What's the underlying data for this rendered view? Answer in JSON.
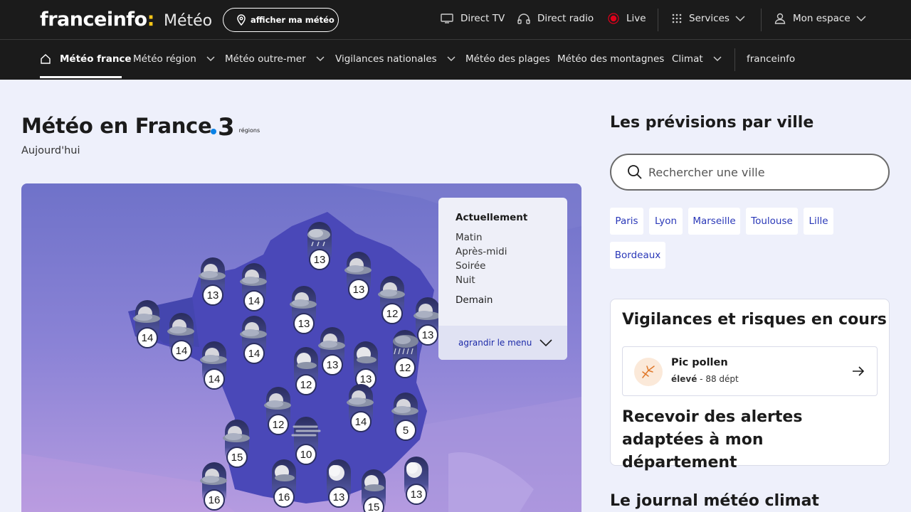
{
  "header": {
    "logo_main": "franceinfo",
    "logo_colon": ":",
    "logo_section": "Météo",
    "locate_button": "afficher ma météo",
    "nav": {
      "direct_tv": "Direct TV",
      "direct_radio": "Direct radio",
      "live": "Live",
      "services": "Services",
      "account": "Mon espace"
    }
  },
  "subnav": {
    "items": [
      "Météo france",
      "Météo région",
      "Météo outre-mer",
      "Vigilances nationales",
      "Météo des plages",
      "Météo des montagnes",
      "Climat",
      "franceinfo"
    ]
  },
  "main": {
    "title": "Météo en France",
    "partner_number": "3",
    "partner_label": "régions",
    "subtitle": "Aujourd'hui"
  },
  "map": {
    "markers": [
      {
        "temp": "13",
        "icon": "cloudy-rain-icon"
      },
      {
        "temp": "13",
        "icon": "cloudy-icon"
      },
      {
        "temp": "14",
        "icon": "cloudy-icon"
      },
      {
        "temp": "13",
        "icon": "cloudy-icon"
      },
      {
        "temp": "12",
        "icon": "cloudy-icon"
      },
      {
        "temp": "13",
        "icon": "cloudy-icon"
      },
      {
        "temp": "14",
        "icon": "cloudy-icon"
      },
      {
        "temp": "14",
        "icon": "cloudy-icon"
      },
      {
        "temp": "14",
        "icon": "cloudy-icon"
      },
      {
        "temp": "13",
        "icon": "cloudy-icon"
      },
      {
        "temp": "13",
        "icon": "cloudy-icon"
      },
      {
        "temp": "13",
        "icon": "sun-cloud-icon"
      },
      {
        "temp": "12",
        "icon": "storm-rain-icon"
      },
      {
        "temp": "14",
        "icon": "cloudy-icon"
      },
      {
        "temp": "12",
        "icon": "sun-cloud-icon"
      },
      {
        "temp": "12",
        "icon": "cloudy-icon"
      },
      {
        "temp": "14",
        "icon": "cloudy-icon"
      },
      {
        "temp": "5",
        "icon": "cloudy-icon"
      },
      {
        "temp": "15",
        "icon": "cloudy-icon"
      },
      {
        "temp": "10",
        "icon": "fog-icon"
      },
      {
        "temp": "16",
        "icon": "cloudy-icon"
      },
      {
        "temp": "16",
        "icon": "sun-cloud-icon"
      },
      {
        "temp": "13",
        "icon": "sun-icon"
      },
      {
        "temp": "15",
        "icon": "sun-cloud-icon"
      },
      {
        "temp": "13",
        "icon": "sun-icon"
      }
    ],
    "menu": {
      "current": "Actuellement",
      "periods": [
        "Matin",
        "Après-midi",
        "Soirée",
        "Nuit"
      ],
      "tomorrow": "Demain",
      "expand": "agrandir le menu"
    }
  },
  "sidebar": {
    "forecast_title": "Les prévisions par ville",
    "search_placeholder": "Rechercher une ville",
    "cities": [
      "Paris",
      "Lyon",
      "Marseille",
      "Toulouse",
      "Lille",
      "Bordeaux"
    ],
    "vigilance": {
      "title": "Vigilances et risques en cours",
      "pollen_title": "Pic pollen",
      "pollen_level": "élevé",
      "pollen_dept": " - 88 dépt",
      "alerts_title": "Recevoir des alertes adaptées à mon département"
    },
    "journal_title": "Le journal météo climat"
  },
  "colors": {
    "topbar": "#1b1b1b",
    "accent_yellow": "#f5c518",
    "live_red": "#e0001a",
    "link_blue": "#2a38b8",
    "map_france": "#4a48b8"
  }
}
